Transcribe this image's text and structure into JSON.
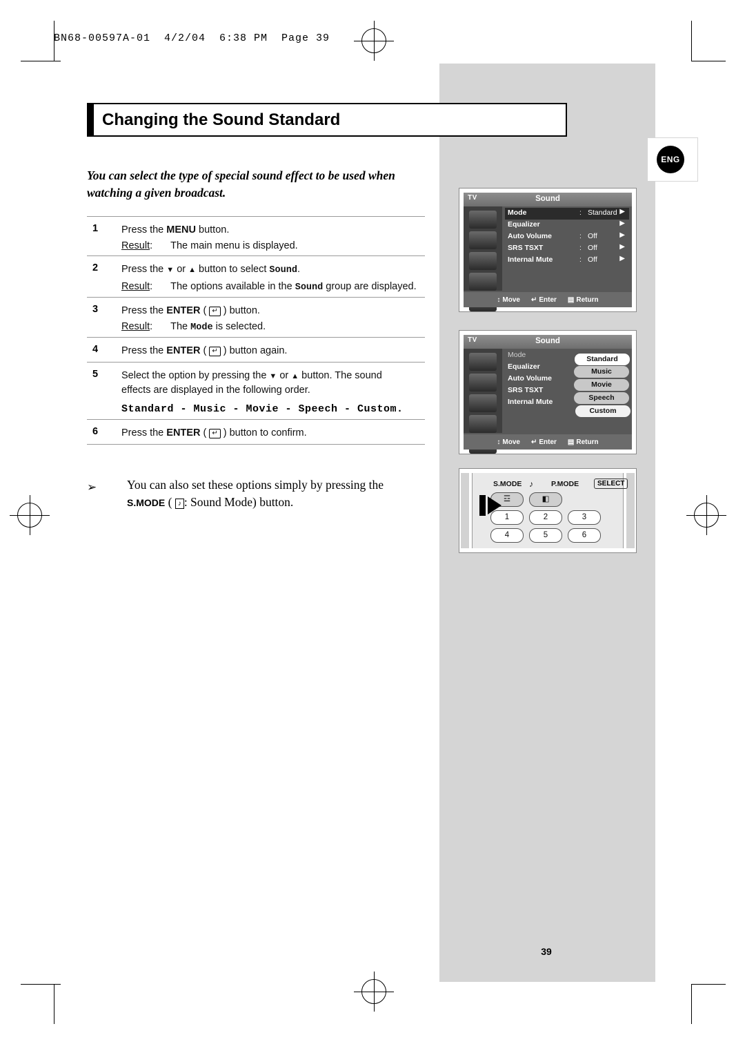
{
  "header_line": "BN68-00597A-01  4/2/04  6:38 PM  Page 39",
  "badge": {
    "lang": "ENG"
  },
  "title": "Changing the Sound Standard",
  "intro": "You can select the type of special sound effect to be used when watching a given broadcast.",
  "steps": [
    {
      "num": "1",
      "text_parts": [
        "Press the ",
        "MENU",
        " button."
      ],
      "result_label": "Result",
      "result_text": "The main menu is displayed."
    },
    {
      "num": "2",
      "text_parts": [
        "Press the ",
        "▼ or ▲",
        " button to select ",
        "Sound",
        "."
      ],
      "result_label": "Result",
      "result_text_pre": "The options available in the ",
      "result_mono": "Sound",
      "result_text_post": " group are displayed."
    },
    {
      "num": "3",
      "text_parts": [
        "Press the ",
        "ENTER",
        " (",
        "↵",
        ") button."
      ],
      "result_label": "Result",
      "result_text_pre": "The ",
      "result_mono": "Mode",
      "result_text_post": " is selected."
    },
    {
      "num": "4",
      "text_parts": [
        "Press the ",
        "ENTER",
        " (",
        "↵",
        ") button again."
      ]
    },
    {
      "num": "5",
      "text_parts": [
        "Select the option by pressing the ",
        "▼ or ▲",
        " button. The sound effects are displayed in the following order."
      ],
      "order_line": "Standard - Music - Movie - Speech - Custom."
    },
    {
      "num": "6",
      "text_parts": [
        "Press the ",
        "ENTER",
        " (",
        "↵",
        ") button to confirm."
      ]
    }
  ],
  "note": {
    "arrow": "➢",
    "line1": "You can also set these options simply by pressing the",
    "smode_label": "S.MODE",
    "smode_glyph": "♪",
    "line2_tail": ": Sound Mode) button."
  },
  "osd1": {
    "tv_tag": "TV",
    "title": "Sound",
    "rows": [
      {
        "label": "Mode",
        "colon": ":",
        "value": "Standard",
        "arrow": "▶",
        "selected": true
      },
      {
        "label": "Equalizer",
        "colon": "",
        "value": "",
        "arrow": "▶",
        "selected": false
      },
      {
        "label": "Auto Volume",
        "colon": ":",
        "value": "Off",
        "arrow": "▶",
        "selected": false
      },
      {
        "label": "SRS TSXT",
        "colon": ":",
        "value": "Off",
        "arrow": "▶",
        "selected": false
      },
      {
        "label": "Internal Mute",
        "colon": ":",
        "value": "Off",
        "arrow": "▶",
        "selected": false
      }
    ],
    "footer": [
      {
        "icon": "↕",
        "label": "Move"
      },
      {
        "icon": "↵",
        "label": "Enter"
      },
      {
        "icon": "▤",
        "label": "Return"
      }
    ]
  },
  "osd2": {
    "tv_tag": "TV",
    "title": "Sound",
    "rows": [
      {
        "label": "Mode",
        "colon": ":"
      },
      {
        "label": "Equalizer",
        "colon": ""
      },
      {
        "label": "Auto Volume",
        "colon": ":"
      },
      {
        "label": "SRS TSXT",
        "colon": ""
      },
      {
        "label": "Internal Mute",
        "colon": ":"
      }
    ],
    "options": [
      {
        "label": "Standard",
        "selected": true
      },
      {
        "label": "Music",
        "selected": false
      },
      {
        "label": "Movie",
        "selected": false
      },
      {
        "label": "Speech",
        "selected": false
      },
      {
        "label": "Custom",
        "selected": false
      }
    ],
    "footer": [
      {
        "icon": "↕",
        "label": "Move"
      },
      {
        "icon": "↵",
        "label": "Enter"
      },
      {
        "icon": "▤",
        "label": "Return"
      }
    ]
  },
  "remote": {
    "smode_label": "S.MODE",
    "smode_note": "♪",
    "pmode_label": "P.MODE",
    "select_label": "SELECT",
    "buttons_row1": [
      "☲",
      "◧"
    ],
    "buttons_row2": [
      "1",
      "2",
      "3"
    ],
    "buttons_row3": [
      "4",
      "5",
      "6"
    ]
  },
  "page_number": "39"
}
